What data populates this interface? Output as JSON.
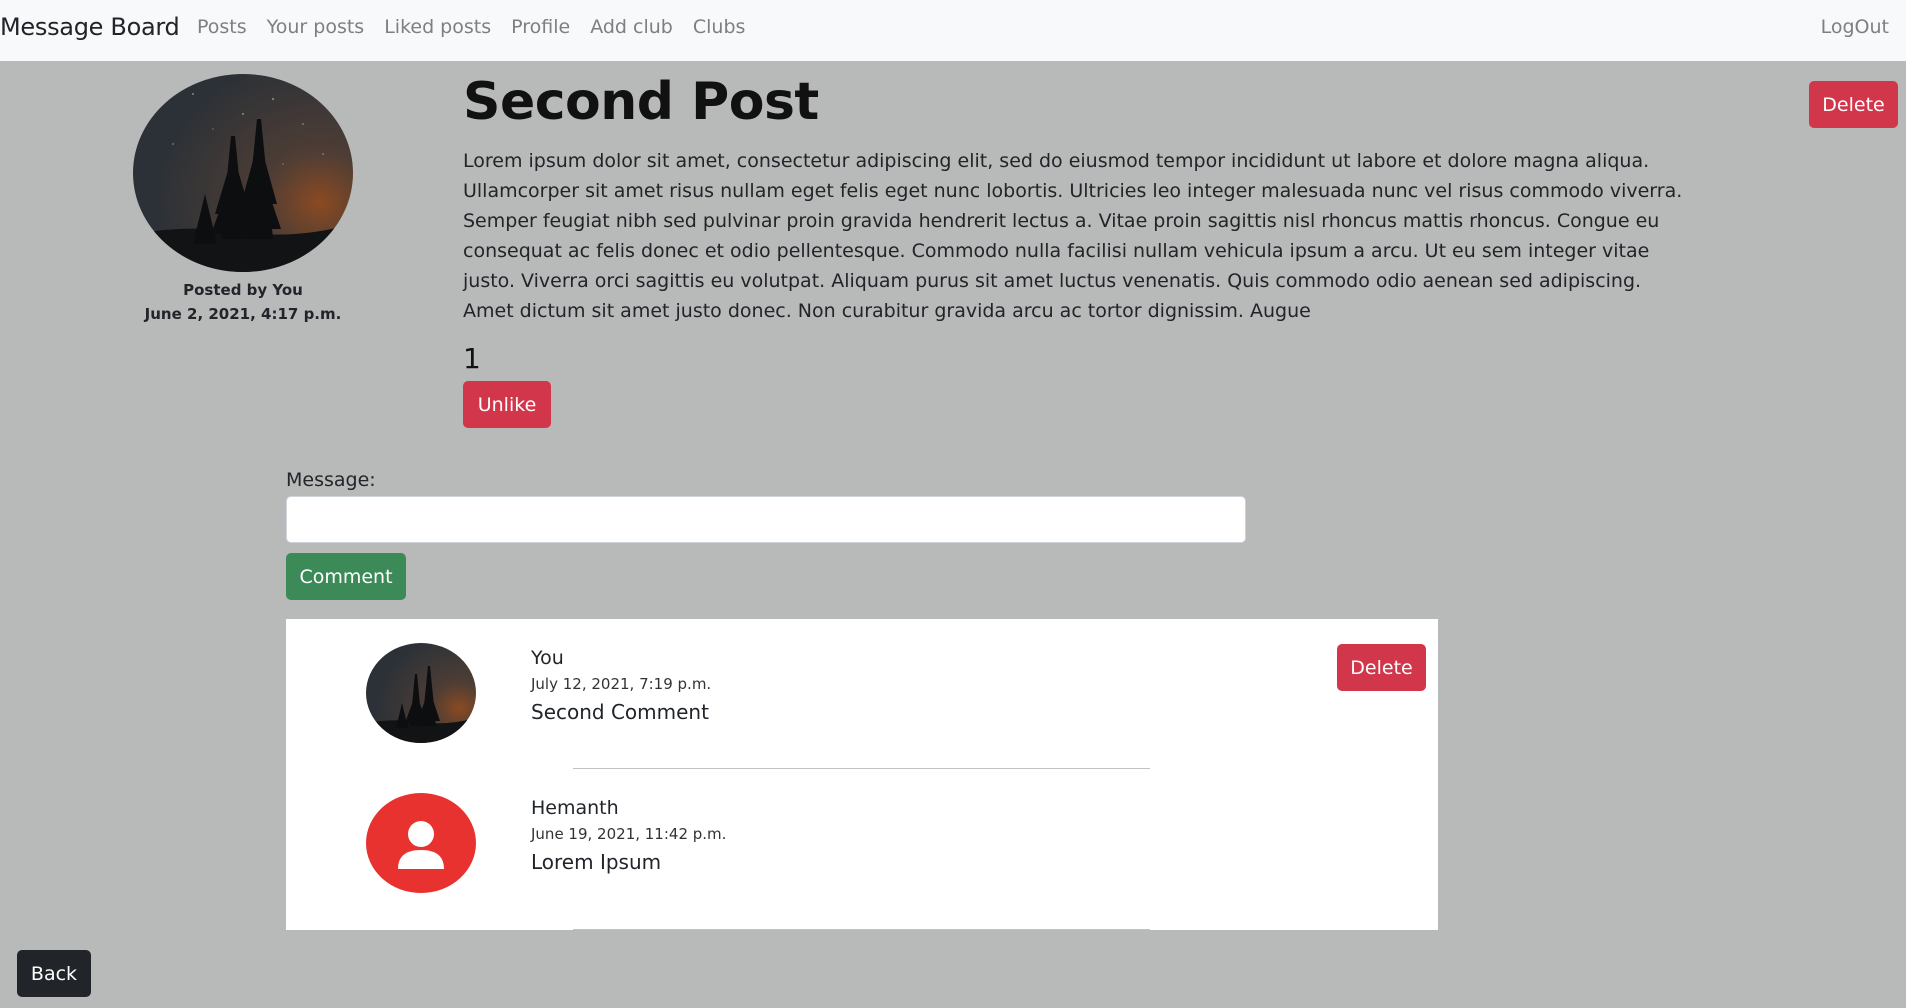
{
  "nav": {
    "brand": "Message Board",
    "links": [
      "Posts",
      "Your posts",
      "Liked posts",
      "Profile",
      "Add club",
      "Clubs"
    ],
    "logout": "LogOut"
  },
  "post": {
    "author_line": "Posted by You",
    "date": "June 2, 2021, 4:17 p.m.",
    "title": "Second Post",
    "body": "Lorem ipsum dolor sit amet, consectetur adipiscing elit, sed do eiusmod tempor incididunt ut labore et dolore magna aliqua. Ullamcorper sit amet risus nullam eget felis eget nunc lobortis. Ultricies leo integer malesuada nunc vel risus commodo viverra. Semper feugiat nibh sed pulvinar proin gravida hendrerit lectus a. Vitae proin sagittis nisl rhoncus mattis rhoncus. Congue eu consequat ac felis donec et odio pellentesque. Commodo nulla facilisi nullam vehicula ipsum a arcu. Ut eu sem integer vitae justo. Viverra orci sagittis eu volutpat. Aliquam purus sit amet luctus venenatis. Quis commodo odio aenean sed adipiscing. Amet dictum sit amet justo donec. Non curabitur gravida arcu ac tortor dignissim. Augue",
    "like_count": "1",
    "unlike_label": "Unlike",
    "delete_label": "Delete"
  },
  "comment_form": {
    "label": "Message:",
    "value": "",
    "submit_label": "Comment"
  },
  "comments": [
    {
      "author": "You",
      "date": "July 12, 2021, 7:19 p.m.",
      "text": "Second Comment",
      "delete_label": "Delete",
      "avatar": "night-forest-photo"
    },
    {
      "author": "Hemanth",
      "date": "June 19, 2021, 11:42 p.m.",
      "text": "Lorem Ipsum",
      "avatar": "user-icon"
    }
  ],
  "back_label": "Back",
  "colors": {
    "danger": "#d1364a",
    "success": "#3b8a57",
    "dark": "#212529",
    "avatar_red": "#e8322f"
  }
}
